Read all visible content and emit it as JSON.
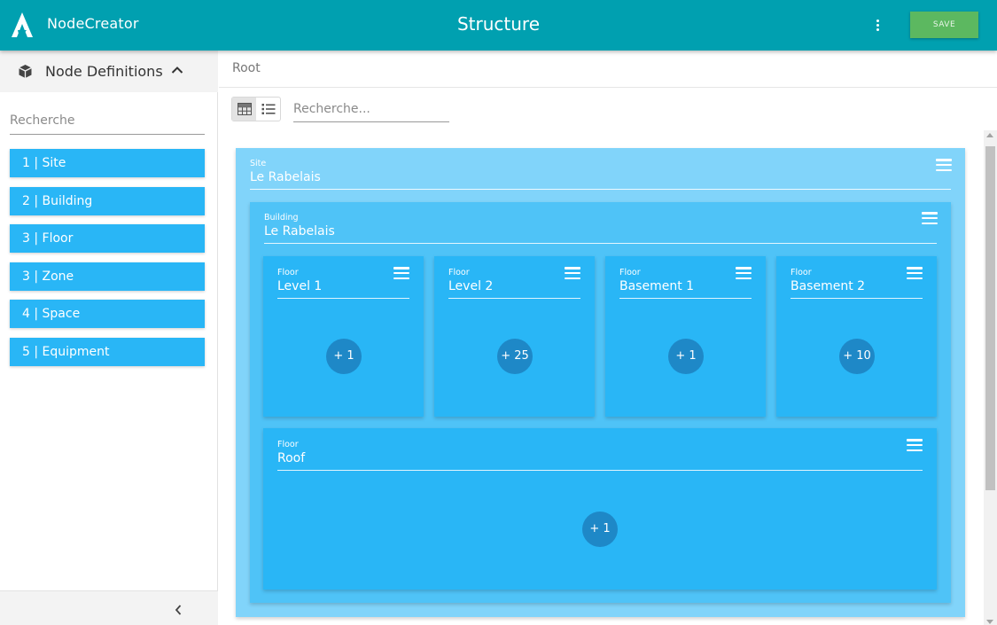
{
  "header": {
    "app_name": "NodeCreator",
    "title": "Structure",
    "save_label": "SAVE",
    "colors": {
      "bar": "#00a0b0",
      "save": "#5cb860"
    }
  },
  "sidebar": {
    "title": "Node Definitions",
    "search_placeholder": "Recherche",
    "items": [
      {
        "label": "1 | Site"
      },
      {
        "label": "2 | Building"
      },
      {
        "label": "3 | Floor"
      },
      {
        "label": "3 | Zone"
      },
      {
        "label": "4 | Space"
      },
      {
        "label": "5 | Equipment"
      }
    ],
    "item_color": "#29b6f6"
  },
  "breadcrumb": {
    "root": "Root"
  },
  "toolbar": {
    "search_placeholder": "Recherche...",
    "view_mode": "grid"
  },
  "structure": {
    "site": {
      "type": "Site",
      "name": "Le Rabelais"
    },
    "building": {
      "type": "Building",
      "name": "Le Rabelais"
    },
    "floors": [
      {
        "type": "Floor",
        "name": "Level 1",
        "count": "+ 1"
      },
      {
        "type": "Floor",
        "name": "Level 2",
        "count": "+ 25"
      },
      {
        "type": "Floor",
        "name": "Basement 1",
        "count": "+ 1"
      },
      {
        "type": "Floor",
        "name": "Basement 2",
        "count": "+ 10"
      }
    ],
    "roof": {
      "type": "Floor",
      "name": "Roof",
      "count": "+ 1"
    },
    "colors": {
      "site": "#81d4fa",
      "building": "#4fc3f7",
      "floor": "#29b6f6",
      "badge": "#1e88c7"
    }
  }
}
